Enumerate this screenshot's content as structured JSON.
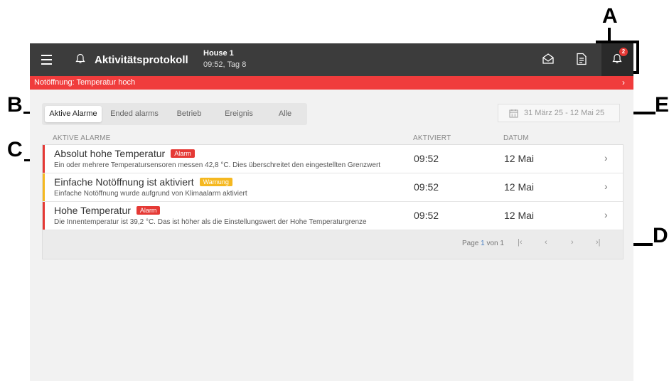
{
  "callouts": {
    "a": "A",
    "b": "B",
    "c": "C",
    "d": "D",
    "e": "E"
  },
  "header": {
    "title": "Aktivitätsprotokoll",
    "house_name": "House 1",
    "house_time": "09:52, Tag 8",
    "alarm_badge_count": "2"
  },
  "banner": {
    "text": "Notöffnung: Temperatur hoch",
    "chevron": "›"
  },
  "tabs": [
    {
      "label": "Aktive Alarme",
      "active": true
    },
    {
      "label": "Ended alarms",
      "active": false
    },
    {
      "label": "Betrieb",
      "active": false
    },
    {
      "label": "Ereignis",
      "active": false
    },
    {
      "label": "Alle",
      "active": false
    }
  ],
  "date_range": {
    "label": "31 März 25 - 12 Mai 25",
    "icon": "calendar-icon"
  },
  "table": {
    "headers": {
      "name": "AKTIVE ALARME",
      "activated": "AKTIVIERT",
      "date": "DATUM"
    },
    "rows": [
      {
        "title": "Absolut hohe Temperatur",
        "tag": "Alarm",
        "description": "Ein oder mehrere Temperatursensoren messen 42,8 °C. Dies überschreitet den eingestellten Grenzwert",
        "activated": "09:52",
        "date": "12 Mai",
        "chevron": "›",
        "color": "#e53935"
      },
      {
        "title": "Einfache Notöffnung ist aktiviert",
        "tag": "Warnung",
        "description": "Einfache Notöffnung wurde aufgrund von Klimaalarm aktiviert",
        "activated": "09:52",
        "date": "12 Mai",
        "chevron": "›",
        "color": "#f5b820"
      },
      {
        "title": "Hohe Temperatur",
        "tag": "Alarm",
        "description": "Die Innentemperatur ist 39,2 °C. Das ist höher als die Einstellungswert der Hohe Temperaturgrenze",
        "activated": "09:52",
        "date": "12 Mai",
        "chevron": "›",
        "color": "#e53935"
      }
    ]
  },
  "pagination": {
    "prefix": "Page",
    "current": "1",
    "separator": "von",
    "total": "1",
    "first": "|‹",
    "prev": "‹",
    "next": "›",
    "last": "›|"
  },
  "colors": {
    "topbar": "#3c3c3c",
    "banner": "#f03c3c",
    "alarm_tag": "#e53935",
    "warning_tag": "#f5b820",
    "page_accent": "#4a7fc1"
  }
}
